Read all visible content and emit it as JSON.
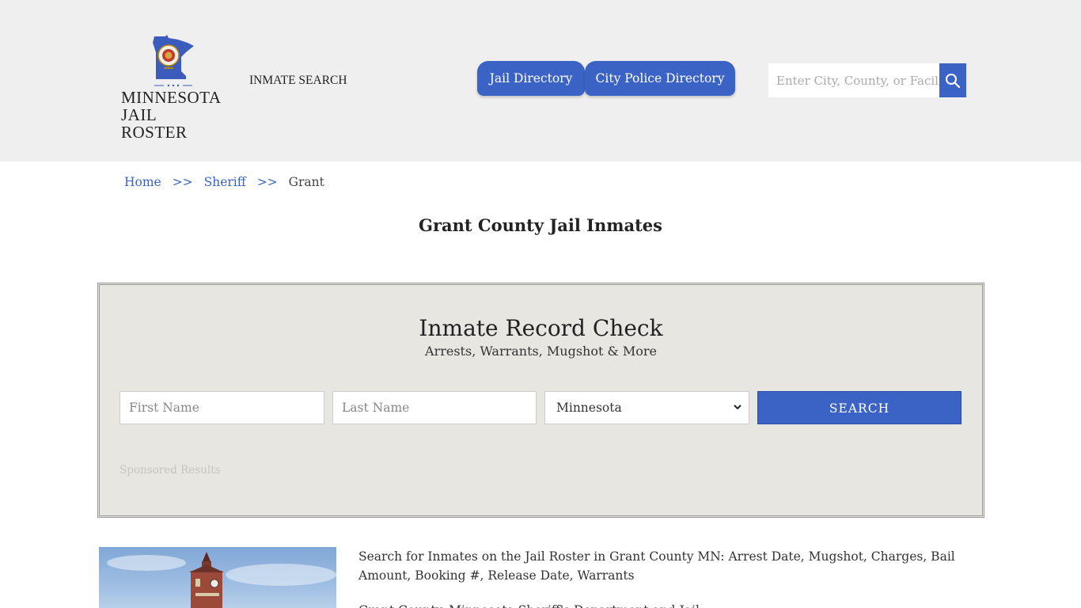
{
  "header": {
    "logo": {
      "line1": "MINNESOTA",
      "line2": "JAIL ROSTER"
    },
    "nav_inmate_search": "INMATE SEARCH",
    "tabs": [
      {
        "label": "Jail Directory"
      },
      {
        "label": "City Police Directory"
      }
    ],
    "search": {
      "placeholder": "Enter City, County, or Facility"
    },
    "accent_color": "#3b63c6",
    "background_color": "#efefef"
  },
  "breadcrumb": {
    "home": "Home",
    "sheriff": "Sheriff",
    "separator": ">>",
    "current": "Grant"
  },
  "page_title": "Grant County Jail Inmates",
  "record_check": {
    "title": "Inmate Record Check",
    "subtitle": "Arrests, Warrants, Mugshot & More",
    "first_name_placeholder": "First Name",
    "last_name_placeholder": "Last Name",
    "state_selected": "Minnesota",
    "search_label": "SEARCH",
    "sponsored_label": "Sponsored Results"
  },
  "content": {
    "intro": "Search for Inmates on the Jail Roster in Grant County MN: Arrest Date, Mugshot, Charges, Bail Amount, Booking #, Release Date, Warrants",
    "intro2": "Grant County, Minnesota Sheriff's Department and Jail"
  }
}
